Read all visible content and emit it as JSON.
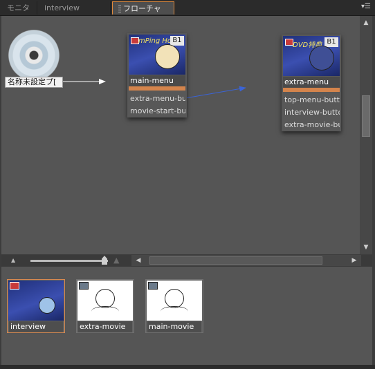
{
  "tabs": [
    {
      "label": "モニタ"
    },
    {
      "label": "interview"
    },
    {
      "label": "フローチャート",
      "close": "×"
    }
  ],
  "disc": {
    "label": "名称未設定プ["
  },
  "nodes": {
    "main": {
      "title": "main-menu",
      "badge": "B1",
      "thumb_text": "mPing Hoshi",
      "rows": [
        "extra-menu-but",
        "movie-start-bu"
      ]
    },
    "extra": {
      "title": "extra-menu",
      "badge": "B1",
      "thumb_text": "DVD特典",
      "rows": [
        "top-menu-butto",
        "interview-butto",
        "extra-movie-bu"
      ]
    }
  },
  "tray": {
    "items": [
      {
        "label": "interview"
      },
      {
        "label": "extra-movie"
      },
      {
        "label": "main-movie"
      }
    ]
  },
  "colors": {
    "accent": "#e08a3c",
    "link_line": "#3b64d6",
    "canvas": "#555555"
  }
}
